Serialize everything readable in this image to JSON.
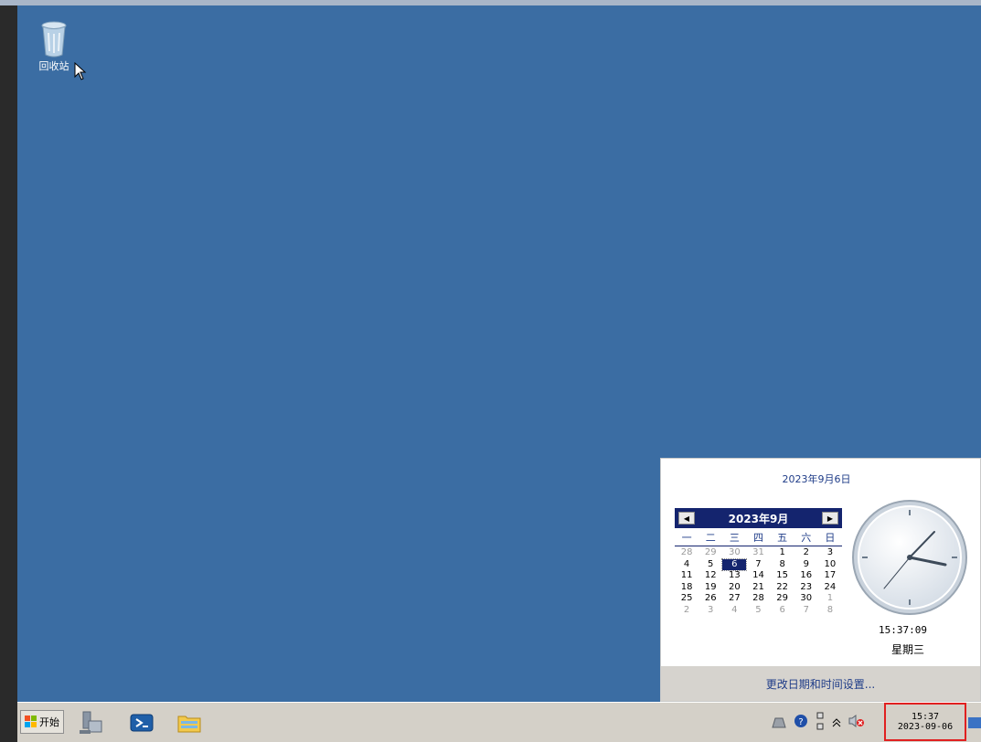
{
  "desktop": {
    "icons": [
      {
        "name": "recycle-bin",
        "label": "回收站"
      }
    ]
  },
  "flyout": {
    "header_date": "2023年9月6日",
    "calendar": {
      "month_title": "2023年9月",
      "prev": "◀",
      "next": "▶",
      "weekdays": [
        "一",
        "二",
        "三",
        "四",
        "五",
        "六",
        "日"
      ],
      "weeks": [
        [
          "28",
          "29",
          "30",
          "31",
          "1",
          "2",
          "3"
        ],
        [
          "4",
          "5",
          "6",
          "7",
          "8",
          "9",
          "10"
        ],
        [
          "11",
          "12",
          "13",
          "14",
          "15",
          "16",
          "17"
        ],
        [
          "18",
          "19",
          "20",
          "21",
          "22",
          "23",
          "24"
        ],
        [
          "25",
          "26",
          "27",
          "28",
          "29",
          "30",
          "1"
        ],
        [
          "2",
          "3",
          "4",
          "5",
          "6",
          "7",
          "8"
        ]
      ],
      "selected_day": "6"
    },
    "clock_time": "15:37:09",
    "weekday": "星期三",
    "change_settings_link": "更改日期和时间设置..."
  },
  "taskbar": {
    "start_label": "开始",
    "quick_launch": [
      "server-manager-icon",
      "powershell-icon",
      "file-explorer-icon"
    ],
    "tray_icons": [
      "action-center-icon",
      "help-icon",
      "network-icon",
      "show-hidden-icons",
      "volume-muted-icon"
    ],
    "clock": {
      "time": "15:37",
      "date": "2023-09-06"
    }
  },
  "colors": {
    "desktop": "#3b6da3",
    "calendar_header": "#14246e",
    "highlight_border": "#e02020"
  }
}
